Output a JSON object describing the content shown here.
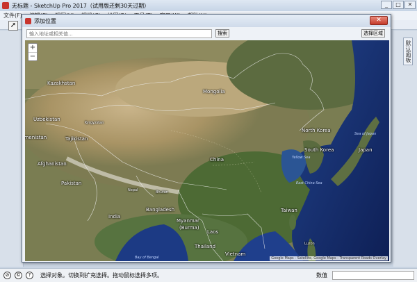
{
  "app": {
    "title": "无标题 - SketchUp Pro 2017（试用版还剩30天过期）",
    "window_controls": [
      "_",
      "□",
      "✕"
    ]
  },
  "menu": {
    "items": [
      "文件(F)",
      "编辑(E)",
      "视图(V)",
      "相机(C)",
      "绘图(R)",
      "工具(T)",
      "窗口(W)",
      "帮助(H)"
    ]
  },
  "right_panel": {
    "tab_label": "默认面板"
  },
  "statusbar": {
    "hint": "选择对象。切换到扩充选择。拖动鼠标选择多项。",
    "measure_label": "数值",
    "measure_value": ""
  },
  "dialog": {
    "title": "添加位置",
    "close": "✕",
    "address_placeholder": "输入地址或相关值...",
    "address_value": "",
    "search_label": "搜索",
    "select_region_label": "选择区域",
    "zoom_in": "+",
    "zoom_out": "−",
    "attribution": "Google Maps - Satellite, Google Maps - Transparent Roads Overlay"
  },
  "map_labels": {
    "kazakhstan": "Kazakhstan",
    "mongolia": "Mongolia",
    "uzbekistan": "Uzbekistan",
    "kyrgyzstan": "Kyrgyzstan",
    "turkmenistan": "Turkmenistan",
    "tajikistan": "Tajikistan",
    "afghanistan": "Afghanistan",
    "pakistan": "Pakistan",
    "north_korea": "North Korea",
    "south_korea": "South Korea",
    "japan": "Japan",
    "china": "China",
    "nepal": "Nepal",
    "bhutan": "Bhutan",
    "bangladesh": "Bangladesh",
    "india": "India",
    "myanmar": "Myanmar",
    "burma": "(Burma)",
    "laos": "Laos",
    "thailand": "Thailand",
    "vietnam": "Vietnam",
    "taiwan": "Taiwan",
    "luzon": "Luzon",
    "sea_of_japan": "Sea of Japan",
    "yellow_sea": "Yellow Sea",
    "east_china_sea": "East China Sea",
    "bay_of_bengal": "Bay of Bengal"
  }
}
